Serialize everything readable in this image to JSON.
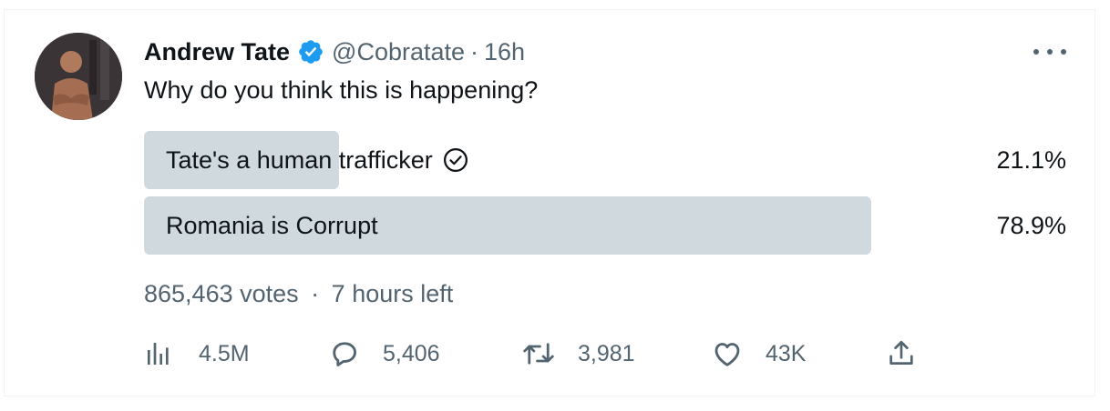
{
  "tweet": {
    "author_name": "Andrew Tate",
    "handle": "@Cobratate",
    "separator": "·",
    "time": "16h",
    "text": "Why do you think this is happening?"
  },
  "poll": {
    "options": [
      {
        "label": "Tate's a human trafficker",
        "percent_text": "21.1%",
        "percent": 21.1,
        "selected": true
      },
      {
        "label": "Romania is Corrupt",
        "percent_text": "78.9%",
        "percent": 78.9,
        "selected": false
      }
    ],
    "votes": "865,463 votes",
    "time_left": "7 hours left"
  },
  "actions": {
    "views": "4.5M",
    "replies": "5,406",
    "retweets": "3,981",
    "likes": "43K"
  },
  "icons": {
    "verified": "verified-badge-icon",
    "more": "more-icon",
    "views": "views-icon",
    "reply": "reply-icon",
    "retweet": "retweet-icon",
    "like": "heart-icon",
    "share": "share-icon",
    "voted": "check-circle-icon"
  },
  "colors": {
    "text": "#0f1419",
    "secondary": "#536471",
    "poll_fill": "#cfd9de",
    "verified_blue": "#1d9bf0"
  }
}
